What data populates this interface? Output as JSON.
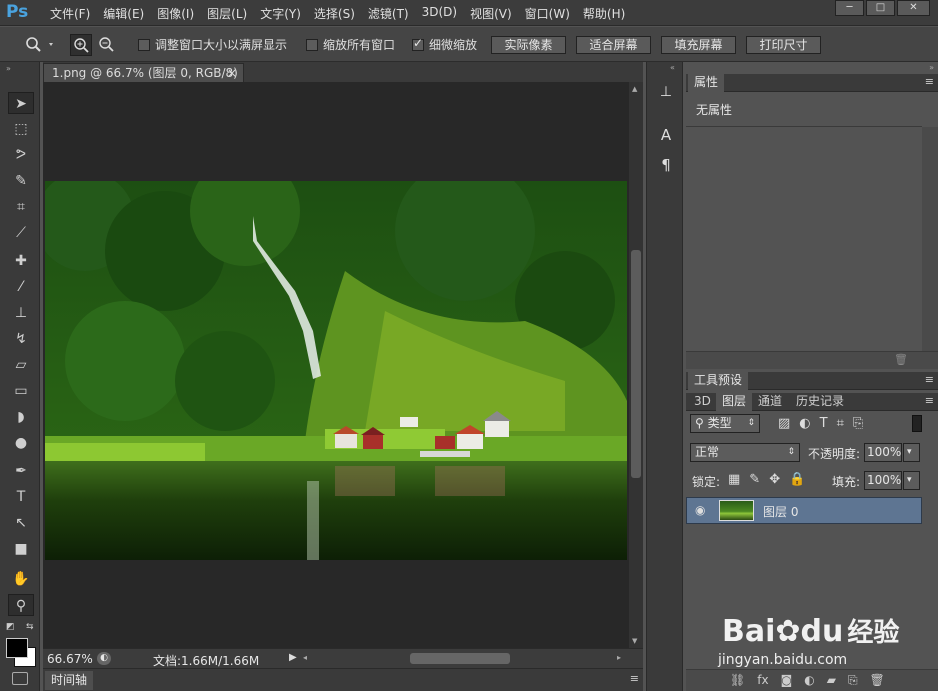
{
  "app": {
    "logo": "Ps",
    "menus": [
      "文件(F)",
      "编辑(E)",
      "图像(I)",
      "图层(L)",
      "文字(Y)",
      "选择(S)",
      "滤镜(T)",
      "3D(D)",
      "视图(V)",
      "窗口(W)",
      "帮助(H)"
    ],
    "window_controls": {
      "minimize": "─",
      "maximize": "□",
      "close": "✕"
    }
  },
  "options": {
    "zoom_icon": "magnifier-icon",
    "resize_window": "调整窗口大小以满屏显示",
    "resize_window_checked": false,
    "zoom_all_windows": "缩放所有窗口",
    "zoom_all_windows_checked": false,
    "scrubby_zoom": "细微缩放",
    "scrubby_zoom_checked": true,
    "btn_actual": "实际像素",
    "btn_fit": "适合屏幕",
    "btn_fill": "填充屏幕",
    "btn_print": "打印尺寸"
  },
  "document": {
    "tab_title": "1.png @ 66.7% (图层 0, RGB/8)",
    "tab_close": "×"
  },
  "status": {
    "zoom": "66.67%",
    "doc_info": "文档:1.66M/1.66M"
  },
  "timeline": {
    "label": "时间轴"
  },
  "properties": {
    "tab": "属性",
    "content": "无属性"
  },
  "panels": {
    "tool_presets": "工具预设",
    "tabs": [
      "3D",
      "图层",
      "通道",
      "历史记录"
    ],
    "active_tab": 1,
    "filter": "类型",
    "blend_mode": "正常",
    "opacity_label": "不透明度:",
    "opacity_value": "100%",
    "lock_label": "锁定:",
    "fill_label": "填充:",
    "fill_value": "100%"
  },
  "layers": [
    {
      "name": "图层 0",
      "visible": true
    }
  ],
  "watermark": {
    "brand": "Bai",
    "brand2": "du",
    "cn": "经验",
    "url": "jingyan.baidu.com"
  },
  "colors": {
    "accent": "#4aa3df",
    "layer_selected": "#5e7592",
    "canvas_bg": "#282828"
  }
}
